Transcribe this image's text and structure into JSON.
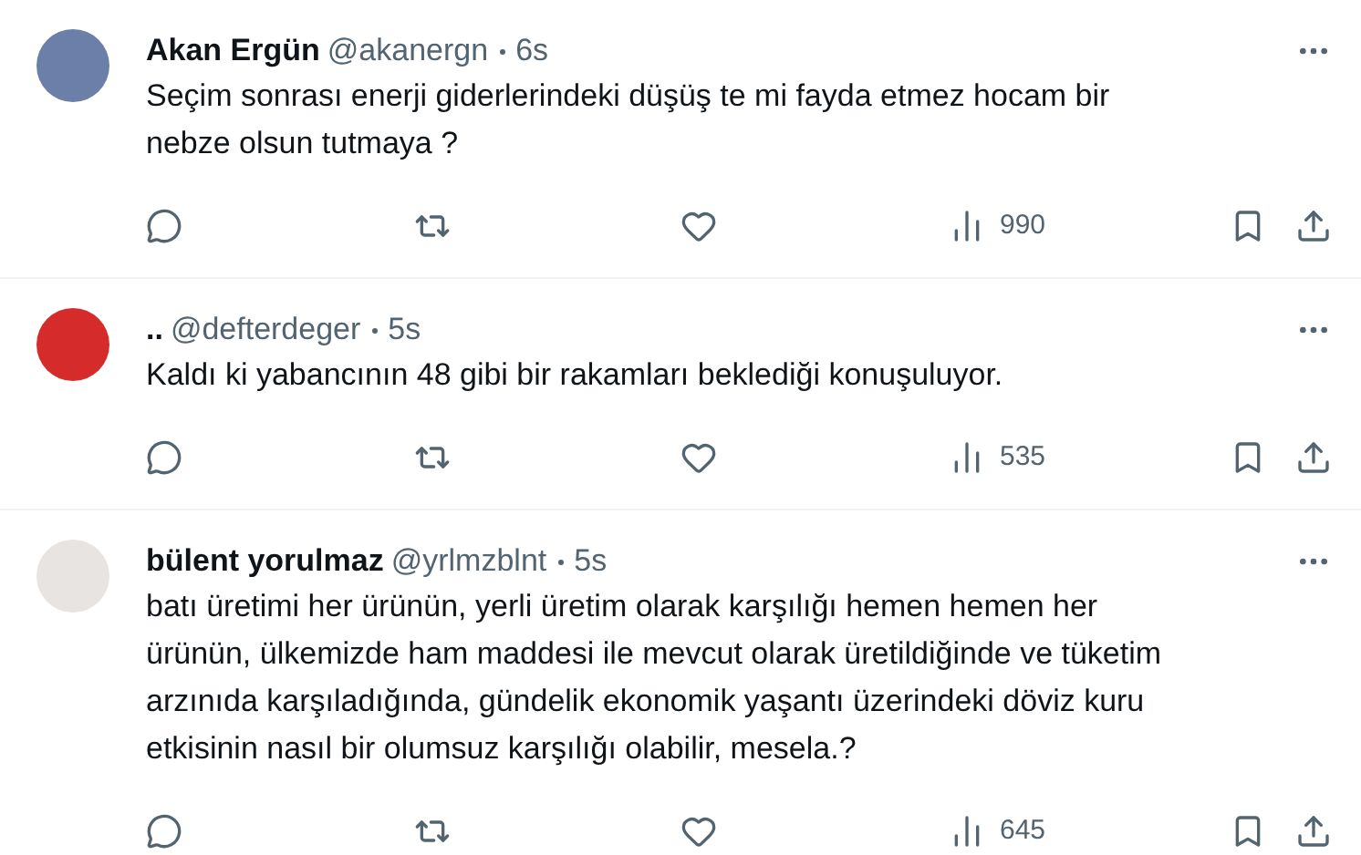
{
  "tweets": [
    {
      "name": "Akan Ergün",
      "handle": "@akanergn",
      "time": "6s",
      "text_lines": [
        "Seçim sonrası enerji giderlerindeki düşüş te mi fayda etmez hocam bir",
        "nebze olsun tutmaya ?"
      ],
      "views": "990"
    },
    {
      "name": "..",
      "handle": "@defterdeger",
      "time": "5s",
      "text_lines": [
        "Kaldı ki yabancının 48 gibi bir rakamları beklediği konuşuluyor."
      ],
      "views": "535"
    },
    {
      "name": "bülent yorulmaz",
      "handle": "@yrlmzblnt",
      "time": "5s",
      "text_lines": [
        "batı üretimi her ürünün, yerli üretim olarak karşılığı hemen hemen her",
        "ürünün, ülkemizde ham maddesi ile mevcut olarak üretildiğinde ve tüketim",
        "arzınıda karşıladığında, gündelik ekonomik yaşantı üzerindeki döviz kuru",
        "etkisinin nasıl bir olumsuz karşılığı olabilir, mesela.?"
      ],
      "views": "645"
    }
  ]
}
